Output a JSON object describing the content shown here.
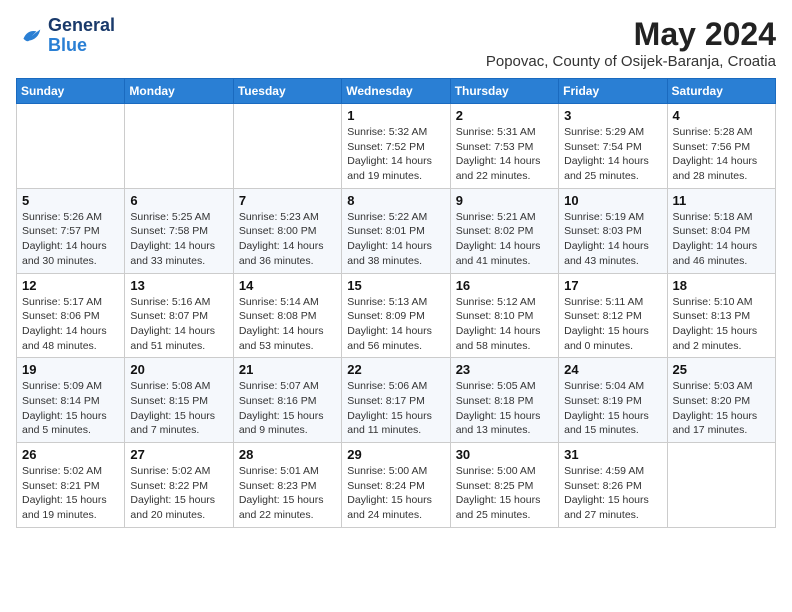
{
  "logo": {
    "line1": "General",
    "line2": "Blue"
  },
  "title": "May 2024",
  "subtitle": "Popovac, County of Osijek-Baranja, Croatia",
  "days_header": [
    "Sunday",
    "Monday",
    "Tuesday",
    "Wednesday",
    "Thursday",
    "Friday",
    "Saturday"
  ],
  "weeks": [
    [
      {
        "day": "",
        "info": ""
      },
      {
        "day": "",
        "info": ""
      },
      {
        "day": "",
        "info": ""
      },
      {
        "day": "1",
        "info": "Sunrise: 5:32 AM\nSunset: 7:52 PM\nDaylight: 14 hours\nand 19 minutes."
      },
      {
        "day": "2",
        "info": "Sunrise: 5:31 AM\nSunset: 7:53 PM\nDaylight: 14 hours\nand 22 minutes."
      },
      {
        "day": "3",
        "info": "Sunrise: 5:29 AM\nSunset: 7:54 PM\nDaylight: 14 hours\nand 25 minutes."
      },
      {
        "day": "4",
        "info": "Sunrise: 5:28 AM\nSunset: 7:56 PM\nDaylight: 14 hours\nand 28 minutes."
      }
    ],
    [
      {
        "day": "5",
        "info": "Sunrise: 5:26 AM\nSunset: 7:57 PM\nDaylight: 14 hours\nand 30 minutes."
      },
      {
        "day": "6",
        "info": "Sunrise: 5:25 AM\nSunset: 7:58 PM\nDaylight: 14 hours\nand 33 minutes."
      },
      {
        "day": "7",
        "info": "Sunrise: 5:23 AM\nSunset: 8:00 PM\nDaylight: 14 hours\nand 36 minutes."
      },
      {
        "day": "8",
        "info": "Sunrise: 5:22 AM\nSunset: 8:01 PM\nDaylight: 14 hours\nand 38 minutes."
      },
      {
        "day": "9",
        "info": "Sunrise: 5:21 AM\nSunset: 8:02 PM\nDaylight: 14 hours\nand 41 minutes."
      },
      {
        "day": "10",
        "info": "Sunrise: 5:19 AM\nSunset: 8:03 PM\nDaylight: 14 hours\nand 43 minutes."
      },
      {
        "day": "11",
        "info": "Sunrise: 5:18 AM\nSunset: 8:04 PM\nDaylight: 14 hours\nand 46 minutes."
      }
    ],
    [
      {
        "day": "12",
        "info": "Sunrise: 5:17 AM\nSunset: 8:06 PM\nDaylight: 14 hours\nand 48 minutes."
      },
      {
        "day": "13",
        "info": "Sunrise: 5:16 AM\nSunset: 8:07 PM\nDaylight: 14 hours\nand 51 minutes."
      },
      {
        "day": "14",
        "info": "Sunrise: 5:14 AM\nSunset: 8:08 PM\nDaylight: 14 hours\nand 53 minutes."
      },
      {
        "day": "15",
        "info": "Sunrise: 5:13 AM\nSunset: 8:09 PM\nDaylight: 14 hours\nand 56 minutes."
      },
      {
        "day": "16",
        "info": "Sunrise: 5:12 AM\nSunset: 8:10 PM\nDaylight: 14 hours\nand 58 minutes."
      },
      {
        "day": "17",
        "info": "Sunrise: 5:11 AM\nSunset: 8:12 PM\nDaylight: 15 hours\nand 0 minutes."
      },
      {
        "day": "18",
        "info": "Sunrise: 5:10 AM\nSunset: 8:13 PM\nDaylight: 15 hours\nand 2 minutes."
      }
    ],
    [
      {
        "day": "19",
        "info": "Sunrise: 5:09 AM\nSunset: 8:14 PM\nDaylight: 15 hours\nand 5 minutes."
      },
      {
        "day": "20",
        "info": "Sunrise: 5:08 AM\nSunset: 8:15 PM\nDaylight: 15 hours\nand 7 minutes."
      },
      {
        "day": "21",
        "info": "Sunrise: 5:07 AM\nSunset: 8:16 PM\nDaylight: 15 hours\nand 9 minutes."
      },
      {
        "day": "22",
        "info": "Sunrise: 5:06 AM\nSunset: 8:17 PM\nDaylight: 15 hours\nand 11 minutes."
      },
      {
        "day": "23",
        "info": "Sunrise: 5:05 AM\nSunset: 8:18 PM\nDaylight: 15 hours\nand 13 minutes."
      },
      {
        "day": "24",
        "info": "Sunrise: 5:04 AM\nSunset: 8:19 PM\nDaylight: 15 hours\nand 15 minutes."
      },
      {
        "day": "25",
        "info": "Sunrise: 5:03 AM\nSunset: 8:20 PM\nDaylight: 15 hours\nand 17 minutes."
      }
    ],
    [
      {
        "day": "26",
        "info": "Sunrise: 5:02 AM\nSunset: 8:21 PM\nDaylight: 15 hours\nand 19 minutes."
      },
      {
        "day": "27",
        "info": "Sunrise: 5:02 AM\nSunset: 8:22 PM\nDaylight: 15 hours\nand 20 minutes."
      },
      {
        "day": "28",
        "info": "Sunrise: 5:01 AM\nSunset: 8:23 PM\nDaylight: 15 hours\nand 22 minutes."
      },
      {
        "day": "29",
        "info": "Sunrise: 5:00 AM\nSunset: 8:24 PM\nDaylight: 15 hours\nand 24 minutes."
      },
      {
        "day": "30",
        "info": "Sunrise: 5:00 AM\nSunset: 8:25 PM\nDaylight: 15 hours\nand 25 minutes."
      },
      {
        "day": "31",
        "info": "Sunrise: 4:59 AM\nSunset: 8:26 PM\nDaylight: 15 hours\nand 27 minutes."
      },
      {
        "day": "",
        "info": ""
      }
    ]
  ]
}
